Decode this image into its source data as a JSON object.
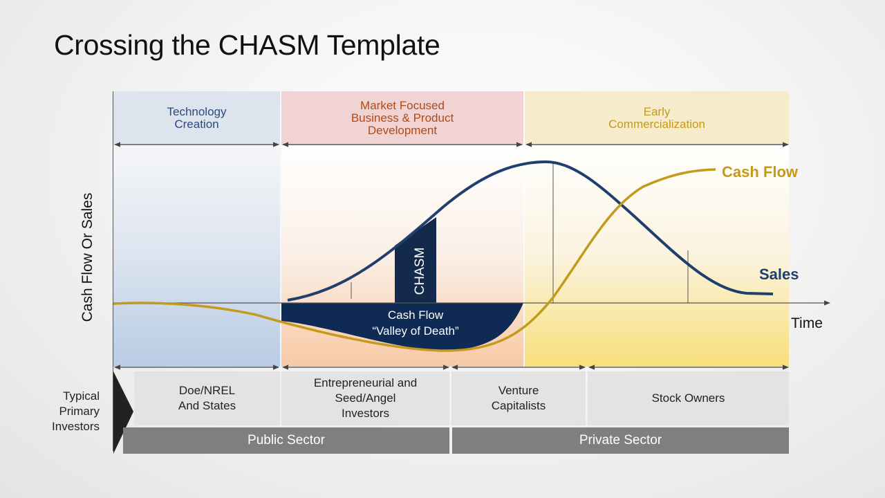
{
  "title": "Crossing the CHASM Template",
  "phases": [
    {
      "label_lines": [
        "Technology",
        "Creation"
      ],
      "text_color": "#2a4a7b",
      "bg": "#dde4ee"
    },
    {
      "label_lines": [
        "Market Focused",
        "Business & Product",
        "Development"
      ],
      "text_color": "#b04a12",
      "bg": "#f2d3d3"
    },
    {
      "label_lines": [
        "Early",
        "Commercialization"
      ],
      "text_color": "#c49a1a",
      "bg": "#f6ebcb"
    }
  ],
  "chart": {
    "y_axis_label": "Cash Flow Or Sales",
    "x_axis_label": "Time",
    "series": [
      {
        "name": "Cash Flow",
        "color": "#c39a1b"
      },
      {
        "name": "Sales",
        "color": "#1f3f6e"
      }
    ],
    "chasm_label": "CHASM",
    "valley_lines": [
      "Cash Flow",
      "“Valley of Death”"
    ],
    "valley_color": "#0f2b55"
  },
  "investors": {
    "row_label_lines": [
      "Typical",
      "Primary",
      "Investors"
    ],
    "cells": [
      {
        "lines": [
          "Doe/NREL",
          "And States"
        ]
      },
      {
        "lines": [
          "Entrepreneurial and",
          "Seed/Angel",
          "Investors"
        ]
      },
      {
        "lines": [
          "Venture",
          "Capitalists"
        ]
      },
      {
        "lines": [
          "Stock Owners"
        ]
      }
    ],
    "sectors": [
      {
        "label": "Public Sector"
      },
      {
        "label": "Private Sector"
      }
    ]
  }
}
